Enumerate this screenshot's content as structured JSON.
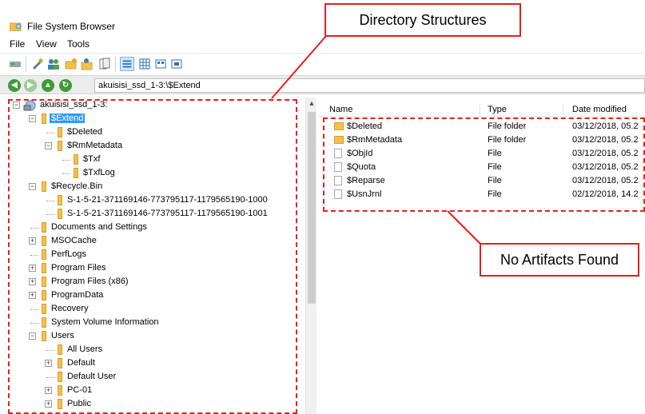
{
  "app": {
    "title": "File System Browser"
  },
  "menu": [
    "File",
    "View",
    "Tools"
  ],
  "address": {
    "path": "akuisisi_ssd_1-3:\\$Extend"
  },
  "tree": [
    {
      "label": "akuisisi_ssd_1-3:",
      "level": 0,
      "expander": "−",
      "kind": "drive"
    },
    {
      "label": "$Extend",
      "level": 1,
      "expander": "−",
      "selected": true
    },
    {
      "label": "$Deleted",
      "level": 2,
      "expander": ""
    },
    {
      "label": "$RmMetadata",
      "level": 2,
      "expander": "−"
    },
    {
      "label": "$Txf",
      "level": 3,
      "expander": ""
    },
    {
      "label": "$TxfLog",
      "level": 3,
      "expander": ""
    },
    {
      "label": "$Recycle.Bin",
      "level": 1,
      "expander": "−"
    },
    {
      "label": "S-1-5-21-371169146-773795117-1179565190-1000",
      "level": 2,
      "expander": ""
    },
    {
      "label": "S-1-5-21-371169146-773795117-1179565190-1001",
      "level": 2,
      "expander": ""
    },
    {
      "label": "Documents and Settings",
      "level": 1,
      "expander": ""
    },
    {
      "label": "MSOCache",
      "level": 1,
      "expander": "+"
    },
    {
      "label": "PerfLogs",
      "level": 1,
      "expander": ""
    },
    {
      "label": "Program Files",
      "level": 1,
      "expander": "+"
    },
    {
      "label": "Program Files (x86)",
      "level": 1,
      "expander": "+"
    },
    {
      "label": "ProgramData",
      "level": 1,
      "expander": "+"
    },
    {
      "label": "Recovery",
      "level": 1,
      "expander": ""
    },
    {
      "label": "System Volume Information",
      "level": 1,
      "expander": ""
    },
    {
      "label": "Users",
      "level": 1,
      "expander": "−"
    },
    {
      "label": "All Users",
      "level": 2,
      "expander": ""
    },
    {
      "label": "Default",
      "level": 2,
      "expander": "+"
    },
    {
      "label": "Default User",
      "level": 2,
      "expander": ""
    },
    {
      "label": "PC-01",
      "level": 2,
      "expander": "+"
    },
    {
      "label": "Public",
      "level": 2,
      "expander": "+"
    }
  ],
  "list": {
    "columns": [
      "Name",
      "Type",
      "Date modified"
    ],
    "rows": [
      {
        "name": "$Deleted",
        "type": "File folder",
        "date": "03/12/2018, 05.2",
        "kind": "folder"
      },
      {
        "name": "$RmMetadata",
        "type": "File folder",
        "date": "03/12/2018, 05.2",
        "kind": "folder"
      },
      {
        "name": "$ObjId",
        "type": "File",
        "date": "03/12/2018, 05.2",
        "kind": "file"
      },
      {
        "name": "$Quota",
        "type": "File",
        "date": "03/12/2018, 05.2",
        "kind": "file"
      },
      {
        "name": "$Reparse",
        "type": "File",
        "date": "03/12/2018, 05.2",
        "kind": "file"
      },
      {
        "name": "$UsnJrnl",
        "type": "File",
        "date": "02/12/2018, 14.2",
        "kind": "file"
      }
    ]
  },
  "callouts": {
    "directory": "Directory Structures",
    "artifacts": "No Artifacts Found"
  },
  "colors": {
    "annotation": "#e32020",
    "selection": "#3399ff",
    "folder": "#f2c14c"
  }
}
